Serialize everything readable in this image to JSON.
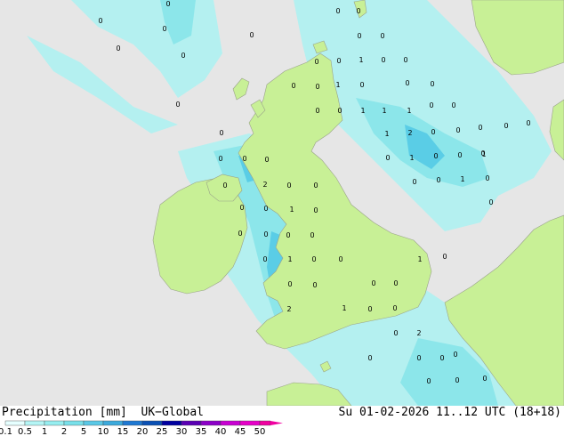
{
  "footer": {
    "product_label": "Precipitation [mm]  UK−Global",
    "datetime_label": "Su 01-02-2026 11..12 UTC (18+18)"
  },
  "legend": {
    "ticks": [
      "0.1",
      "0.5",
      "1",
      "2",
      "5",
      "10",
      "15",
      "20",
      "25",
      "30",
      "35",
      "40",
      "45",
      "50"
    ],
    "colors": [
      "#e6ffff",
      "#b4f5f5",
      "#96eef0",
      "#78e0ea",
      "#5ac8e6",
      "#3caadc",
      "#1e78d2",
      "#0a50b4",
      "#0000a0",
      "#5a00b4",
      "#8c00c8",
      "#c800d2",
      "#e600c8",
      "#f000a0"
    ]
  },
  "map": {
    "sea_color": "#e6e6e6",
    "land_color": "#c8f096",
    "precip_light_color": "#b4f0f0",
    "precip_mid_color": "#8ce6ea",
    "precip_heavy_color": "#5acde6",
    "values": [
      {
        "text": "0"
      },
      {
        "text": "0"
      },
      {
        "text": "0"
      },
      {
        "text": "0"
      },
      {
        "text": "0"
      },
      {
        "text": "0"
      },
      {
        "text": "0"
      },
      {
        "text": "0"
      },
      {
        "text": "0"
      },
      {
        "text": "0"
      },
      {
        "text": "1"
      },
      {
        "text": "0"
      },
      {
        "text": "0"
      },
      {
        "text": "0"
      },
      {
        "text": "0"
      },
      {
        "text": "0"
      },
      {
        "text": "1"
      },
      {
        "text": "0"
      },
      {
        "text": "0"
      },
      {
        "text": "0"
      },
      {
        "text": "0"
      },
      {
        "text": "0"
      },
      {
        "text": "0"
      },
      {
        "text": "0"
      },
      {
        "text": "0"
      },
      {
        "text": "1"
      },
      {
        "text": "1"
      },
      {
        "text": "1"
      },
      {
        "text": "0"
      },
      {
        "text": "0"
      },
      {
        "text": "0"
      },
      {
        "text": "0"
      },
      {
        "text": "0"
      },
      {
        "text": "1"
      },
      {
        "text": "2"
      },
      {
        "text": "0"
      },
      {
        "text": "0"
      },
      {
        "text": "0"
      },
      {
        "text": "0"
      },
      {
        "text": "0"
      },
      {
        "text": "0"
      },
      {
        "text": "0"
      },
      {
        "text": "1"
      },
      {
        "text": "0"
      },
      {
        "text": "0"
      },
      {
        "text": "0"
      },
      {
        "text": "2"
      },
      {
        "text": "0"
      },
      {
        "text": "0"
      },
      {
        "text": "1"
      },
      {
        "text": "0"
      },
      {
        "text": "0"
      },
      {
        "text": "0"
      },
      {
        "text": "0"
      },
      {
        "text": "1"
      },
      {
        "text": "0"
      },
      {
        "text": "0"
      },
      {
        "text": "0"
      },
      {
        "text": "0"
      },
      {
        "text": "0"
      },
      {
        "text": "0"
      },
      {
        "text": "0"
      },
      {
        "text": "0"
      },
      {
        "text": "1"
      },
      {
        "text": "0"
      },
      {
        "text": "0"
      },
      {
        "text": "1"
      },
      {
        "text": "0"
      },
      {
        "text": "0"
      },
      {
        "text": "0"
      },
      {
        "text": "2"
      },
      {
        "text": "0"
      },
      {
        "text": "0"
      },
      {
        "text": "0"
      },
      {
        "text": "2"
      },
      {
        "text": "0"
      },
      {
        "text": "0"
      },
      {
        "text": "0"
      },
      {
        "text": "0"
      },
      {
        "text": "0"
      },
      {
        "text": "0"
      },
      {
        "text": "0"
      },
      {
        "text": "1"
      },
      {
        "text": "0"
      },
      {
        "text": "1"
      },
      {
        "text": "0"
      }
    ]
  }
}
